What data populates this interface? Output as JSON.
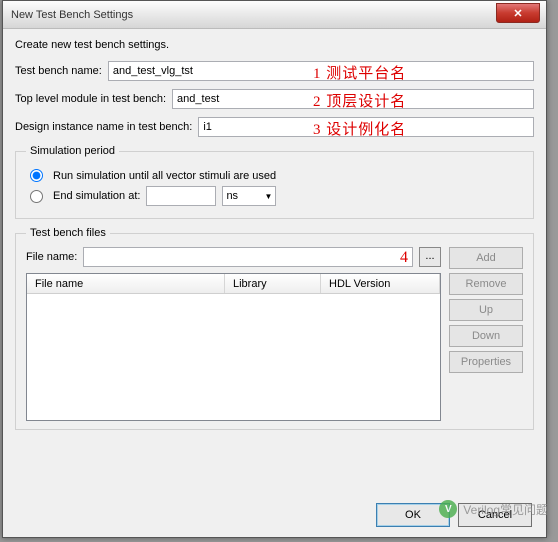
{
  "window": {
    "title": "New Test Bench Settings"
  },
  "desc": "Create new test bench settings.",
  "fields": {
    "tb_name_label": "Test bench name:",
    "tb_name_value": "and_test_vlg_tst",
    "top_module_label": "Top level module in test bench:",
    "top_module_value": "and_test",
    "instance_label": "Design instance name in test bench:",
    "instance_value": "i1"
  },
  "annotations": {
    "a1": "1 测试平台名",
    "a2": "2 顶层设计名",
    "a3": "3 设计例化名",
    "a4": "4"
  },
  "simulation": {
    "legend": "Simulation period",
    "opt_run": "Run simulation until all vector stimuli are used",
    "opt_end": "End simulation at:",
    "unit": "ns"
  },
  "files": {
    "legend": "Test bench files",
    "filename_label": "File name:",
    "browse": "...",
    "col_file": "File name",
    "col_lib": "Library",
    "col_hdl": "HDL Version"
  },
  "side_buttons": {
    "add": "Add",
    "remove": "Remove",
    "up": "Up",
    "down": "Down",
    "props": "Properties"
  },
  "footer": {
    "ok": "OK",
    "cancel": "Cancel"
  },
  "watermark": {
    "icon": "V",
    "text": "Verilog常见问题"
  }
}
